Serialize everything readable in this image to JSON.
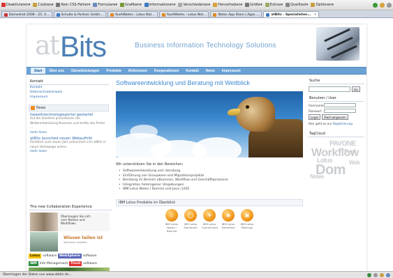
{
  "browser": {
    "bookmarks": [
      {
        "label": "Deaktivieren▾",
        "color": "#d33"
      },
      {
        "label": "Cookies▾",
        "color": "#c8a040"
      },
      {
        "label": "Kein CSS-Fehler▾",
        "color": "#777"
      },
      {
        "label": "Formulare▾",
        "color": "#6a8bc2"
      },
      {
        "label": "Grafiken▾",
        "color": "#7a9a3a"
      },
      {
        "label": "Informationen▾",
        "color": "#3a78c0"
      },
      {
        "label": "Verschiedenes▾",
        "color": "#aaa"
      },
      {
        "label": "Hervorheben▾",
        "color": "#d8a23a"
      },
      {
        "label": "Größe▾",
        "color": "#777"
      },
      {
        "label": "Extras▾",
        "color": "#9a6"
      },
      {
        "label": "Quelltext▾",
        "color": "#888"
      },
      {
        "label": "Optionen▾",
        "color": "#c9a040"
      }
    ],
    "tabs": [
      {
        "label": "Domeshot 2008 - 25. A...",
        "color": "#c33",
        "active": false
      },
      {
        "label": "Schulte & Partner Gmbh...",
        "color": "#3a78c0",
        "active": false
      },
      {
        "label": "YouAtNotes - Lotus Not...",
        "color": "#e08a20",
        "active": false
      },
      {
        "label": "YouAtNotes - Lotus Not...",
        "color": "#e08a20",
        "active": false
      },
      {
        "label": "Notes App Store | Apps ...",
        "color": "#e08a20",
        "active": false
      },
      {
        "label": "atBits - Spezialisten...",
        "color": "#3a78c0",
        "active": true
      }
    ],
    "status": "Übertragen der Daten von www.atbits.de..."
  },
  "header": {
    "logo_at": "at",
    "logo_bits": "Bits",
    "tagline": "Business Information Technology Solutions"
  },
  "nav": [
    "Start",
    "Über uns",
    "Dienstleistungen",
    "Produkte",
    "Referenzen",
    "Kooperationen",
    "Kontakt",
    "News",
    "Impressum"
  ],
  "left": {
    "contact_title": "Kontakt",
    "contact_links": [
      "Kontakt",
      "Datenschutzhinweis",
      "Impressum"
    ],
    "news_title": "News",
    "news": [
      {
        "title": "Geweihtechnologieportal gestartet",
        "text": "Auf der Domfest präsentieren die Weiterentwicklung Business und stellte das Portal ...",
        "more": "mehr lesen"
      },
      {
        "title": "atBits launched neuen Webauftritt",
        "text": "Pünktlich zum neuen Jahr präsentiert sich atBits in neuer Homepage online.",
        "more": "mehr lesen"
      }
    ],
    "collab_title": "The new Collaboration Experience",
    "ad1_text": [
      "Überzeugen Sie sich",
      "vom Nutzen und",
      "Workflows"
    ],
    "ad2_title": "Wissen teilen ist",
    "ad2_sub": "Vertrauen schaffen",
    "ad3": [
      "Lotus",
      "software",
      "WebSphere",
      "software"
    ],
    "ad4": [
      "IBM",
      "Info Management",
      "Tivoli",
      "software"
    ]
  },
  "center": {
    "title": "Softwareentwicklung und Beratung mit Weitblick",
    "intro": "Wir unterstützen Sie in den Bereichen:",
    "bullets": [
      "Softwareentwicklung und -beratung",
      "Einführung von Groupware und Migrationsprojekte",
      "Beratung im Bereich eBusiness, Workflow und Geschäftsprozesse",
      "Integration heterogener Umgebungen",
      "IBM Lotus Notes / Domino und Java / J2EE"
    ],
    "ibm_title": "IBM Lotus Produkte im Überblick",
    "ibm_products": [
      {
        "l1": "IBM Lotus",
        "l2": "Notes /",
        "l3": "Domino",
        "glyph": "♨"
      },
      {
        "l1": "IBM Lotus",
        "l2": "Sametime",
        "l3": "",
        "glyph": "◯"
      },
      {
        "l1": "IBM Lotus",
        "l2": "Connections",
        "l3": "",
        "glyph": "✲"
      },
      {
        "l1": "IBM Lotus",
        "l2": "Sametime",
        "l3": "",
        "glyph": "◉"
      },
      {
        "l1": "IBM Lotus",
        "l2": "Mashups",
        "l3": "",
        "glyph": "▣"
      }
    ]
  },
  "right": {
    "search_title": "Suche",
    "search_button": "Go",
    "login_title": "Benutzer / User",
    "username_label": "Username",
    "password_label": "Passwort",
    "login_button": "Login",
    "forgot_button": "Pwd vergessen",
    "register_text": "Hier geht es zur",
    "register_link": "Registrierung",
    "tagcloud_title": "TagCloud",
    "tags": [
      "PAVONE",
      "Workflow",
      "Lotus",
      "Dom",
      "Tivoli",
      "Web",
      "Notes"
    ]
  }
}
